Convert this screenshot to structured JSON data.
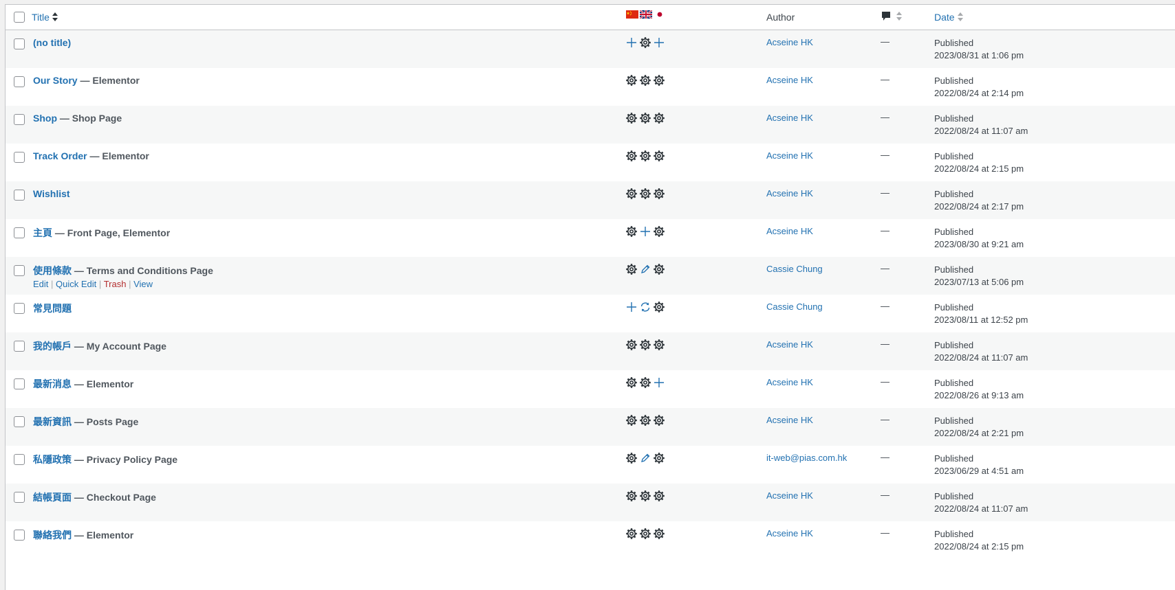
{
  "header": {
    "title_label": "Title",
    "author_label": "Author",
    "date_label": "Date",
    "flags": [
      "china-flag",
      "uk-flag",
      "japan-flag"
    ],
    "comments_icon": "comment-bubble-icon"
  },
  "rows": [
    {
      "title": "(no title)",
      "state": "",
      "icons": [
        "plus",
        "gear",
        "plus"
      ],
      "author": "Acseine HK",
      "comments": "—",
      "status": "Published",
      "date": "2023/08/31 at 1:06 pm"
    },
    {
      "title": "Our Story",
      "state": " — Elementor",
      "icons": [
        "gear",
        "gear",
        "gear"
      ],
      "author": "Acseine HK",
      "comments": "—",
      "status": "Published",
      "date": "2022/08/24 at 2:14 pm"
    },
    {
      "title": "Shop",
      "state": " — Shop Page",
      "icons": [
        "gear",
        "gear",
        "gear"
      ],
      "author": "Acseine HK",
      "comments": "—",
      "status": "Published",
      "date": "2022/08/24 at 11:07 am"
    },
    {
      "title": "Track Order",
      "state": " — Elementor",
      "icons": [
        "gear",
        "gear",
        "gear"
      ],
      "author": "Acseine HK",
      "comments": "—",
      "status": "Published",
      "date": "2022/08/24 at 2:15 pm"
    },
    {
      "title": "Wishlist",
      "state": "",
      "icons": [
        "gear",
        "gear",
        "gear"
      ],
      "author": "Acseine HK",
      "comments": "—",
      "status": "Published",
      "date": "2022/08/24 at 2:17 pm"
    },
    {
      "title": "主頁",
      "state": " — Front Page, Elementor",
      "icons": [
        "gear",
        "plus",
        "gear"
      ],
      "author": "Acseine HK",
      "comments": "—",
      "status": "Published",
      "date": "2023/08/30 at 9:21 am"
    },
    {
      "title": "使用條款",
      "state": " — Terms and Conditions Page",
      "icons": [
        "gear",
        "pencil",
        "gear"
      ],
      "author": "Cassie Chung",
      "comments": "—",
      "status": "Published",
      "date": "2023/07/13 at 5:06 pm",
      "row_actions": {
        "edit": "Edit",
        "quick_edit": "Quick Edit",
        "trash": "Trash",
        "view": "View",
        "sep": "|"
      }
    },
    {
      "title": "常見問題",
      "state": "",
      "icons": [
        "plus",
        "sync",
        "gear"
      ],
      "author": "Cassie Chung",
      "comments": "—",
      "status": "Published",
      "date": "2023/08/11 at 12:52 pm"
    },
    {
      "title": "我的帳戶",
      "state": " — My Account Page",
      "icons": [
        "gear",
        "gear",
        "gear"
      ],
      "author": "Acseine HK",
      "comments": "—",
      "status": "Published",
      "date": "2022/08/24 at 11:07 am"
    },
    {
      "title": "最新消息",
      "state": " — Elementor",
      "icons": [
        "gear",
        "gear",
        "plus"
      ],
      "author": "Acseine HK",
      "comments": "—",
      "status": "Published",
      "date": "2022/08/26 at 9:13 am"
    },
    {
      "title": "最新資訊",
      "state": " — Posts Page",
      "icons": [
        "gear",
        "gear",
        "gear"
      ],
      "author": "Acseine HK",
      "comments": "—",
      "status": "Published",
      "date": "2022/08/24 at 2:21 pm"
    },
    {
      "title": "私隱政策",
      "state": " — Privacy Policy Page",
      "icons": [
        "gear",
        "pencil",
        "gear"
      ],
      "author": "it-web@pias.com.hk",
      "comments": "—",
      "status": "Published",
      "date": "2023/06/29 at 4:51 am"
    },
    {
      "title": "結帳頁面",
      "state": " — Checkout Page",
      "icons": [
        "gear",
        "gear",
        "gear"
      ],
      "author": "Acseine HK",
      "comments": "—",
      "status": "Published",
      "date": "2022/08/24 at 11:07 am"
    },
    {
      "title": "聯絡我們",
      "state": " — Elementor",
      "icons": [
        "gear",
        "gear",
        "gear"
      ],
      "author": "Acseine HK",
      "comments": "—",
      "status": "Published",
      "date": "2022/08/24 at 2:15 pm"
    }
  ]
}
